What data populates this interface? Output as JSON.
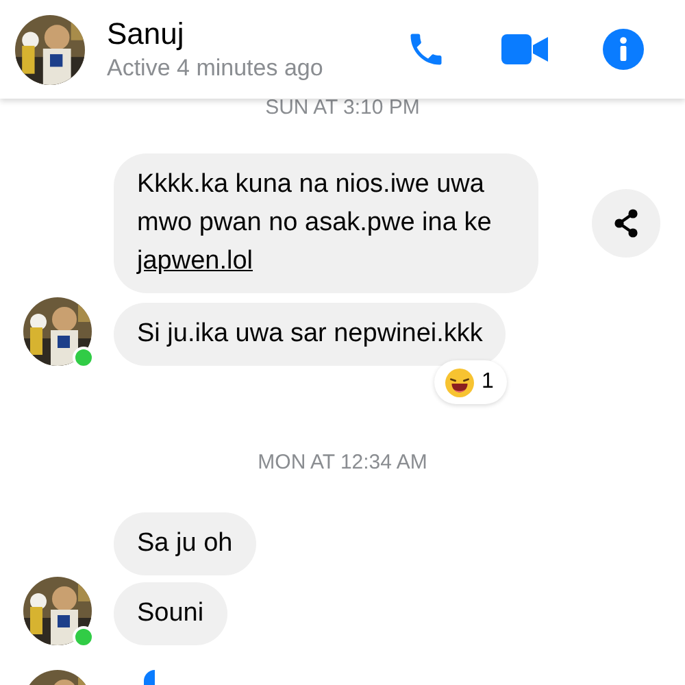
{
  "header": {
    "name": "Sanuj",
    "status": "Active 4 minutes ago"
  },
  "messages": [
    {
      "kind": "date",
      "text": "SUN AT 3:10 PM"
    },
    {
      "kind": "bubble",
      "text": "Kkkk.ka kuna na nios.iwe uwa mwo pwan no asak.pwe ina ke ",
      "link": "japwen.lol",
      "avatar": false,
      "share": true
    },
    {
      "kind": "bubble",
      "text": "Si ju.ika uwa sar nepwinei.kkk",
      "avatar": true,
      "online": true,
      "reaction": {
        "count": "1"
      }
    },
    {
      "kind": "date",
      "text": "MON AT 12:34 AM"
    },
    {
      "kind": "bubble",
      "text": "Sa ju oh",
      "avatar": false
    },
    {
      "kind": "bubble",
      "text": "Souni",
      "avatar": true,
      "online": true
    },
    {
      "kind": "partial",
      "avatar": true
    }
  ]
}
